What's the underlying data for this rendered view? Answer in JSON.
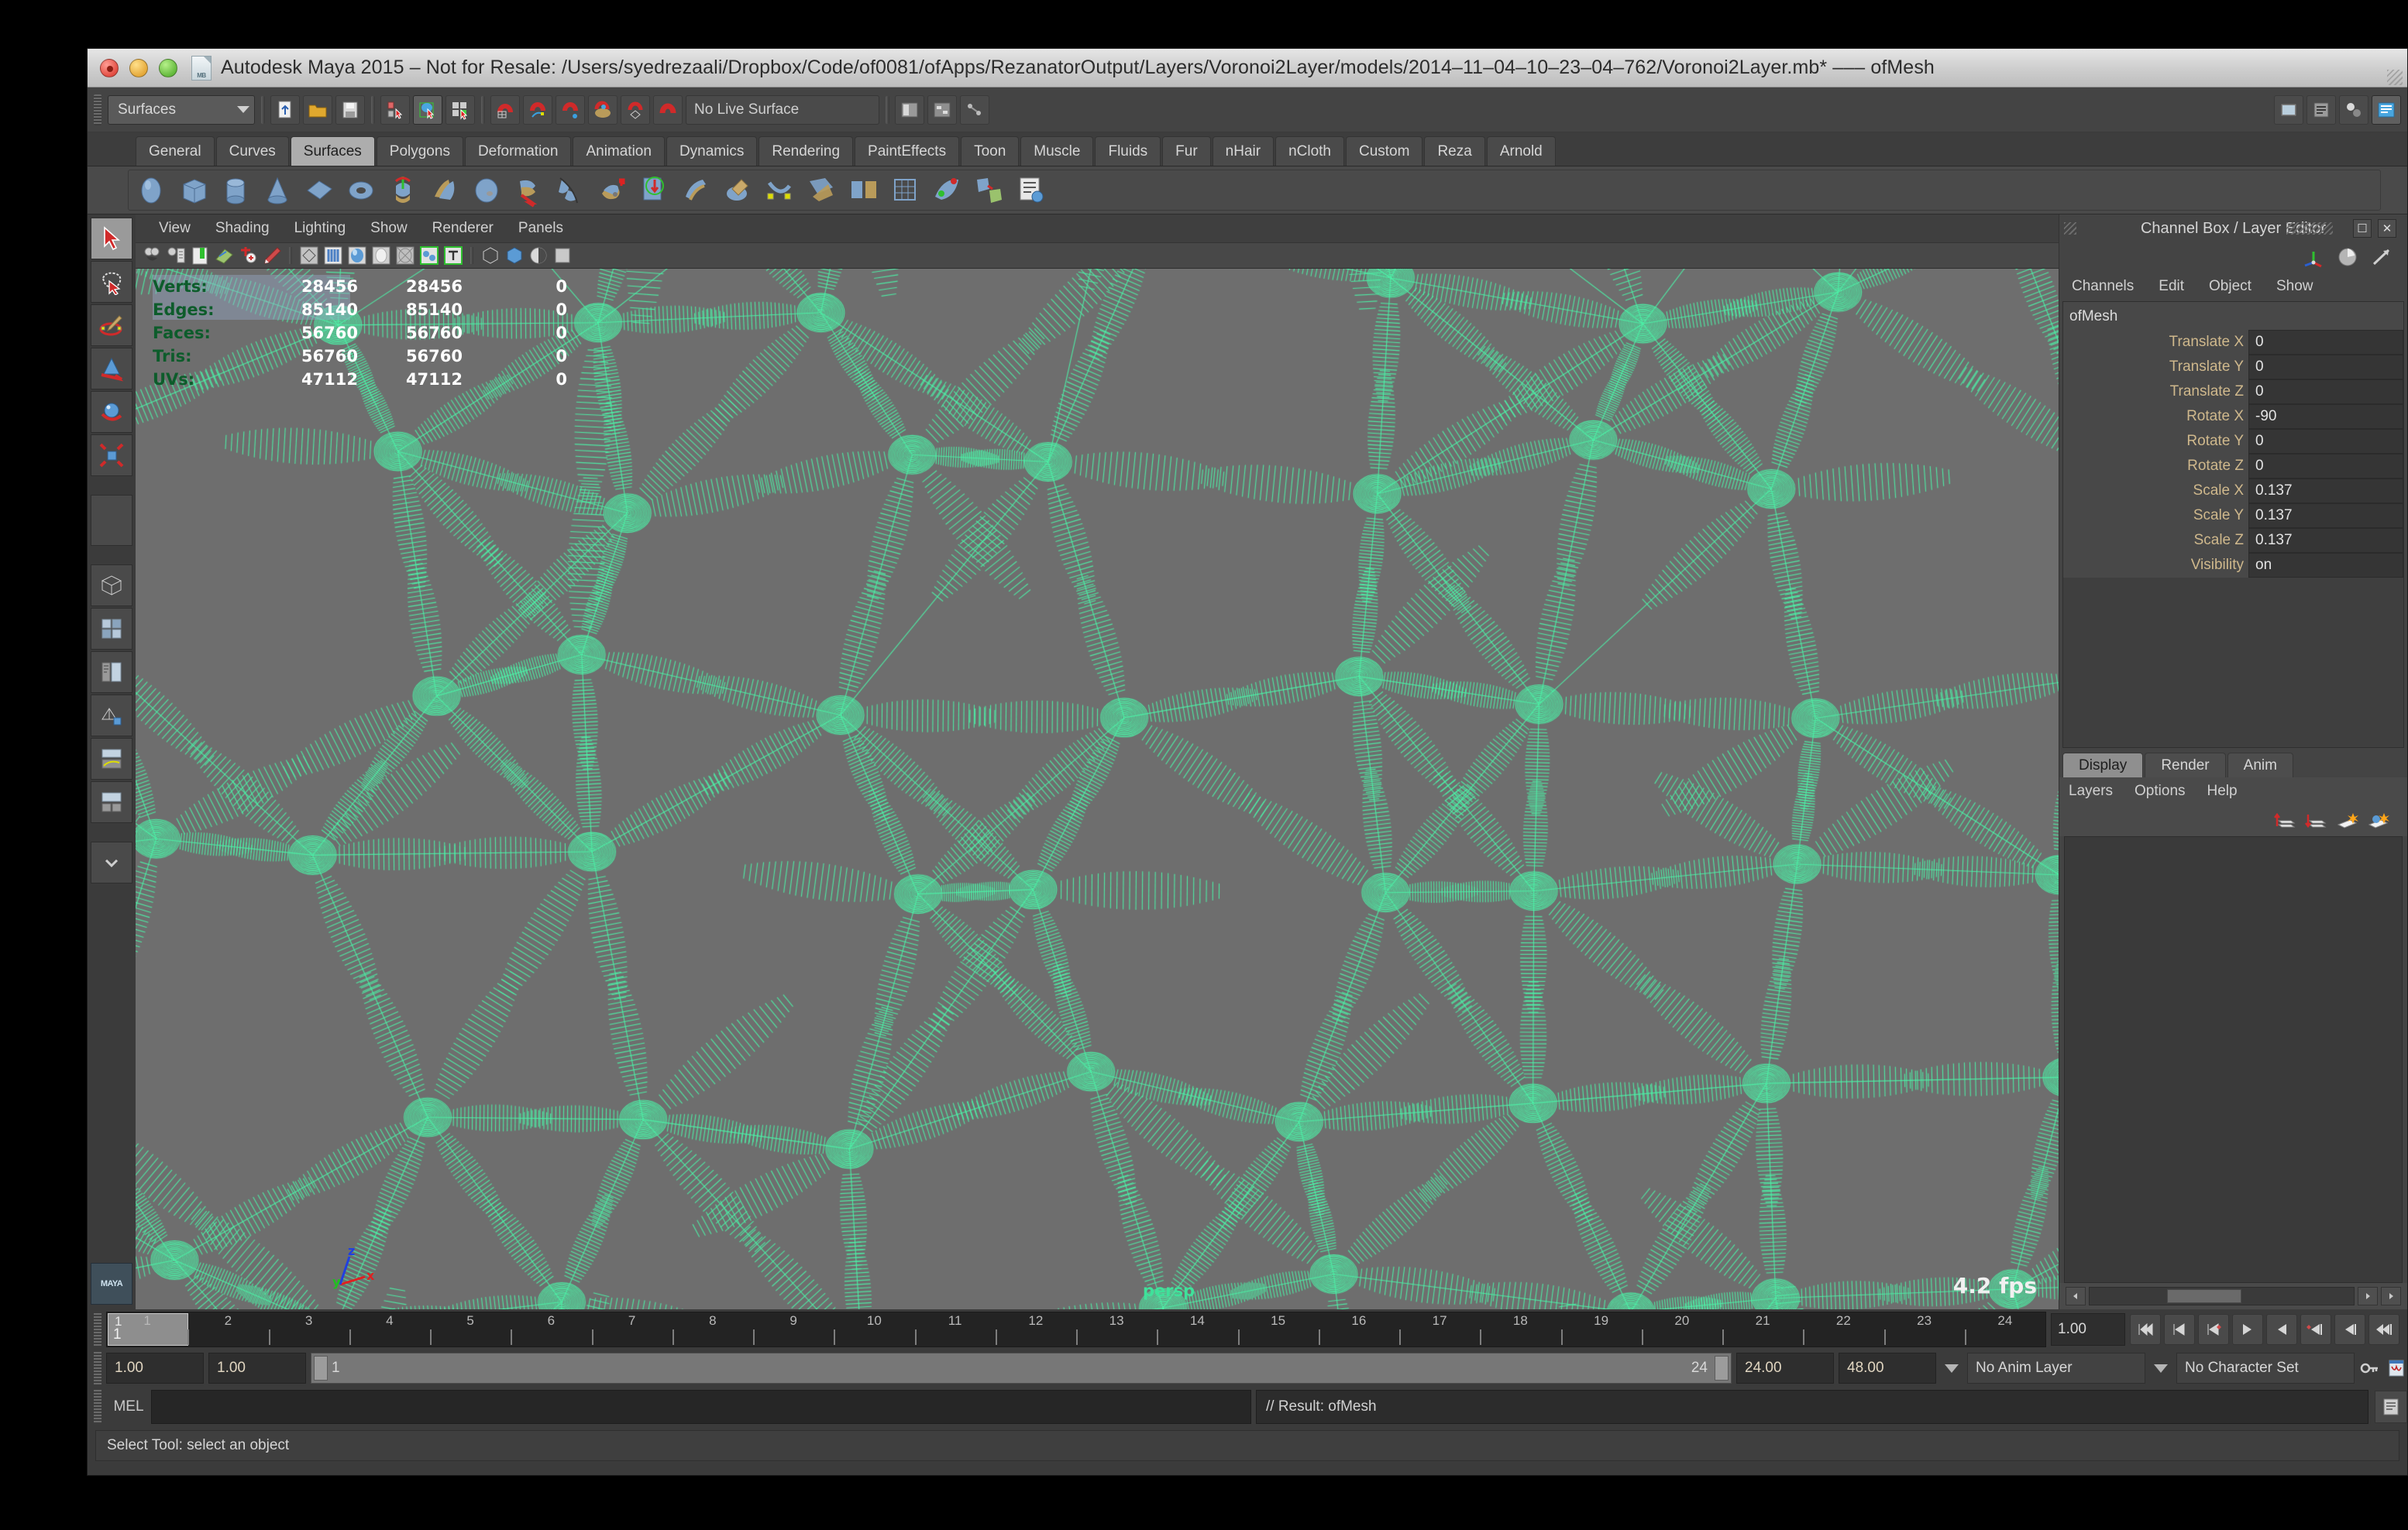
{
  "window": {
    "title": "Autodesk Maya 2015 – Not for Resale: /Users/syedrezaali/Dropbox/Code/of0081/ofApps/RezanatorOutput/Layers/Voronoi2Layer/models/2014–11–04–10–23–04–762/Voronoi2Layer.mb*   –––   ofMesh",
    "file_icon": "maya-binary-file-icon"
  },
  "status_line": {
    "menu_set": "Surfaces",
    "live_surface": "No Live Surface"
  },
  "shelf": {
    "tabs": [
      {
        "label": "General",
        "active": false
      },
      {
        "label": "Curves",
        "active": false
      },
      {
        "label": "Surfaces",
        "active": true
      },
      {
        "label": "Polygons",
        "active": false
      },
      {
        "label": "Deformation",
        "active": false
      },
      {
        "label": "Animation",
        "active": false
      },
      {
        "label": "Dynamics",
        "active": false
      },
      {
        "label": "Rendering",
        "active": false
      },
      {
        "label": "PaintEffects",
        "active": false
      },
      {
        "label": "Toon",
        "active": false
      },
      {
        "label": "Muscle",
        "active": false
      },
      {
        "label": "Fluids",
        "active": false
      },
      {
        "label": "Fur",
        "active": false
      },
      {
        "label": "nHair",
        "active": false
      },
      {
        "label": "nCloth",
        "active": false
      },
      {
        "label": "Custom",
        "active": false
      },
      {
        "label": "Reza",
        "active": false
      },
      {
        "label": "Arnold",
        "active": false
      }
    ]
  },
  "viewport": {
    "menus": [
      "View",
      "Shading",
      "Lighting",
      "Show",
      "Renderer",
      "Panels"
    ],
    "camera_label": "persp",
    "fps": "4.2 fps",
    "axis_labels": [
      "x",
      "y",
      "z"
    ],
    "background_color": "#6e6e6e",
    "wireframe_color": "#4df0a6",
    "hud": {
      "columns": 3,
      "rows": [
        {
          "label": "Verts:",
          "total": "28456",
          "selected": "28456",
          "count": "0"
        },
        {
          "label": "Edges:",
          "total": "85140",
          "selected": "85140",
          "count": "0"
        },
        {
          "label": "Faces:",
          "total": "56760",
          "selected": "56760",
          "count": "0"
        },
        {
          "label": "Tris:",
          "total": "56760",
          "selected": "56760",
          "count": "0"
        },
        {
          "label": "UVs:",
          "total": "47112",
          "selected": "47112",
          "count": "0"
        }
      ]
    }
  },
  "channel_box": {
    "panel_title": "Channel Box / Layer Editor",
    "menus": [
      "Channels",
      "Edit",
      "Object",
      "Show"
    ],
    "object_name": "ofMesh",
    "attributes": [
      {
        "name": "Translate X",
        "value": "0"
      },
      {
        "name": "Translate Y",
        "value": "0"
      },
      {
        "name": "Translate Z",
        "value": "0"
      },
      {
        "name": "Rotate X",
        "value": "-90"
      },
      {
        "name": "Rotate Y",
        "value": "0"
      },
      {
        "name": "Rotate Z",
        "value": "0"
      },
      {
        "name": "Scale X",
        "value": "0.137"
      },
      {
        "name": "Scale Y",
        "value": "0.137"
      },
      {
        "name": "Scale Z",
        "value": "0.137"
      },
      {
        "name": "Visibility",
        "value": "on"
      }
    ]
  },
  "layer_editor": {
    "tabs": [
      {
        "label": "Display",
        "active": true
      },
      {
        "label": "Render",
        "active": false
      },
      {
        "label": "Anim",
        "active": false
      }
    ],
    "menus": [
      "Layers",
      "Options",
      "Help"
    ]
  },
  "time_slider": {
    "current_frame": "1",
    "current_frame_top": "1",
    "ticks": [
      "1",
      "2",
      "3",
      "4",
      "5",
      "6",
      "7",
      "8",
      "9",
      "10",
      "11",
      "12",
      "13",
      "14",
      "15",
      "16",
      "17",
      "18",
      "19",
      "20",
      "21",
      "22",
      "23",
      "24"
    ],
    "frame_field": "1.00"
  },
  "range_slider": {
    "anim_start": "1.00",
    "range_start": "1.00",
    "slider_left_label": "1",
    "slider_right_label": "24",
    "range_end": "24.00",
    "anim_end": "48.00",
    "anim_layer": "No Anim Layer",
    "character_set": "No Character Set"
  },
  "command_line": {
    "language": "MEL",
    "input_value": "",
    "result": "// Result: ofMesh"
  },
  "help_line": {
    "text": "Select Tool: select an object"
  }
}
